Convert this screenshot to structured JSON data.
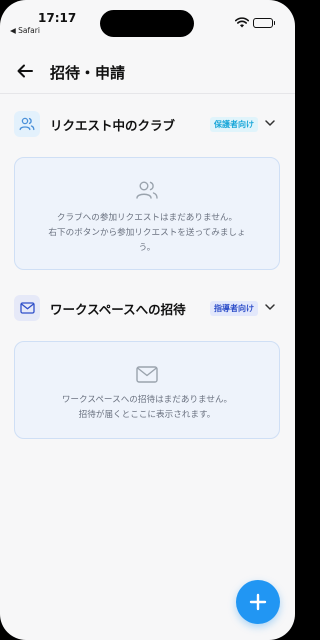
{
  "status_bar": {
    "time": "17:17",
    "back_app": "◀ Safari"
  },
  "header": {
    "title": "招待・申請"
  },
  "sections": [
    {
      "title": "リクエスト中のクラブ",
      "badge": "保護者向け",
      "badge_color": "#1aa7d9",
      "badge_bg": "#e0f4fb",
      "icon": "users-icon",
      "empty_line1": "クラブへの参加リクエストはまだありません。",
      "empty_line2": "右下のボタンから参加リクエストを送ってみましょ",
      "empty_line3": "う。"
    },
    {
      "title": "ワークスペースへの招待",
      "badge": "指導者向け",
      "badge_color": "#2f4fc9",
      "badge_bg": "#e3e8fb",
      "icon": "mail-icon",
      "empty_line1": "ワークスペースへの招待はまだありません。",
      "empty_line2": "招待が届くとここに表示されます。"
    }
  ],
  "colors": {
    "accent": "#2196f3",
    "card_bg": "#eef3fb",
    "card_border": "#cfdff5"
  }
}
